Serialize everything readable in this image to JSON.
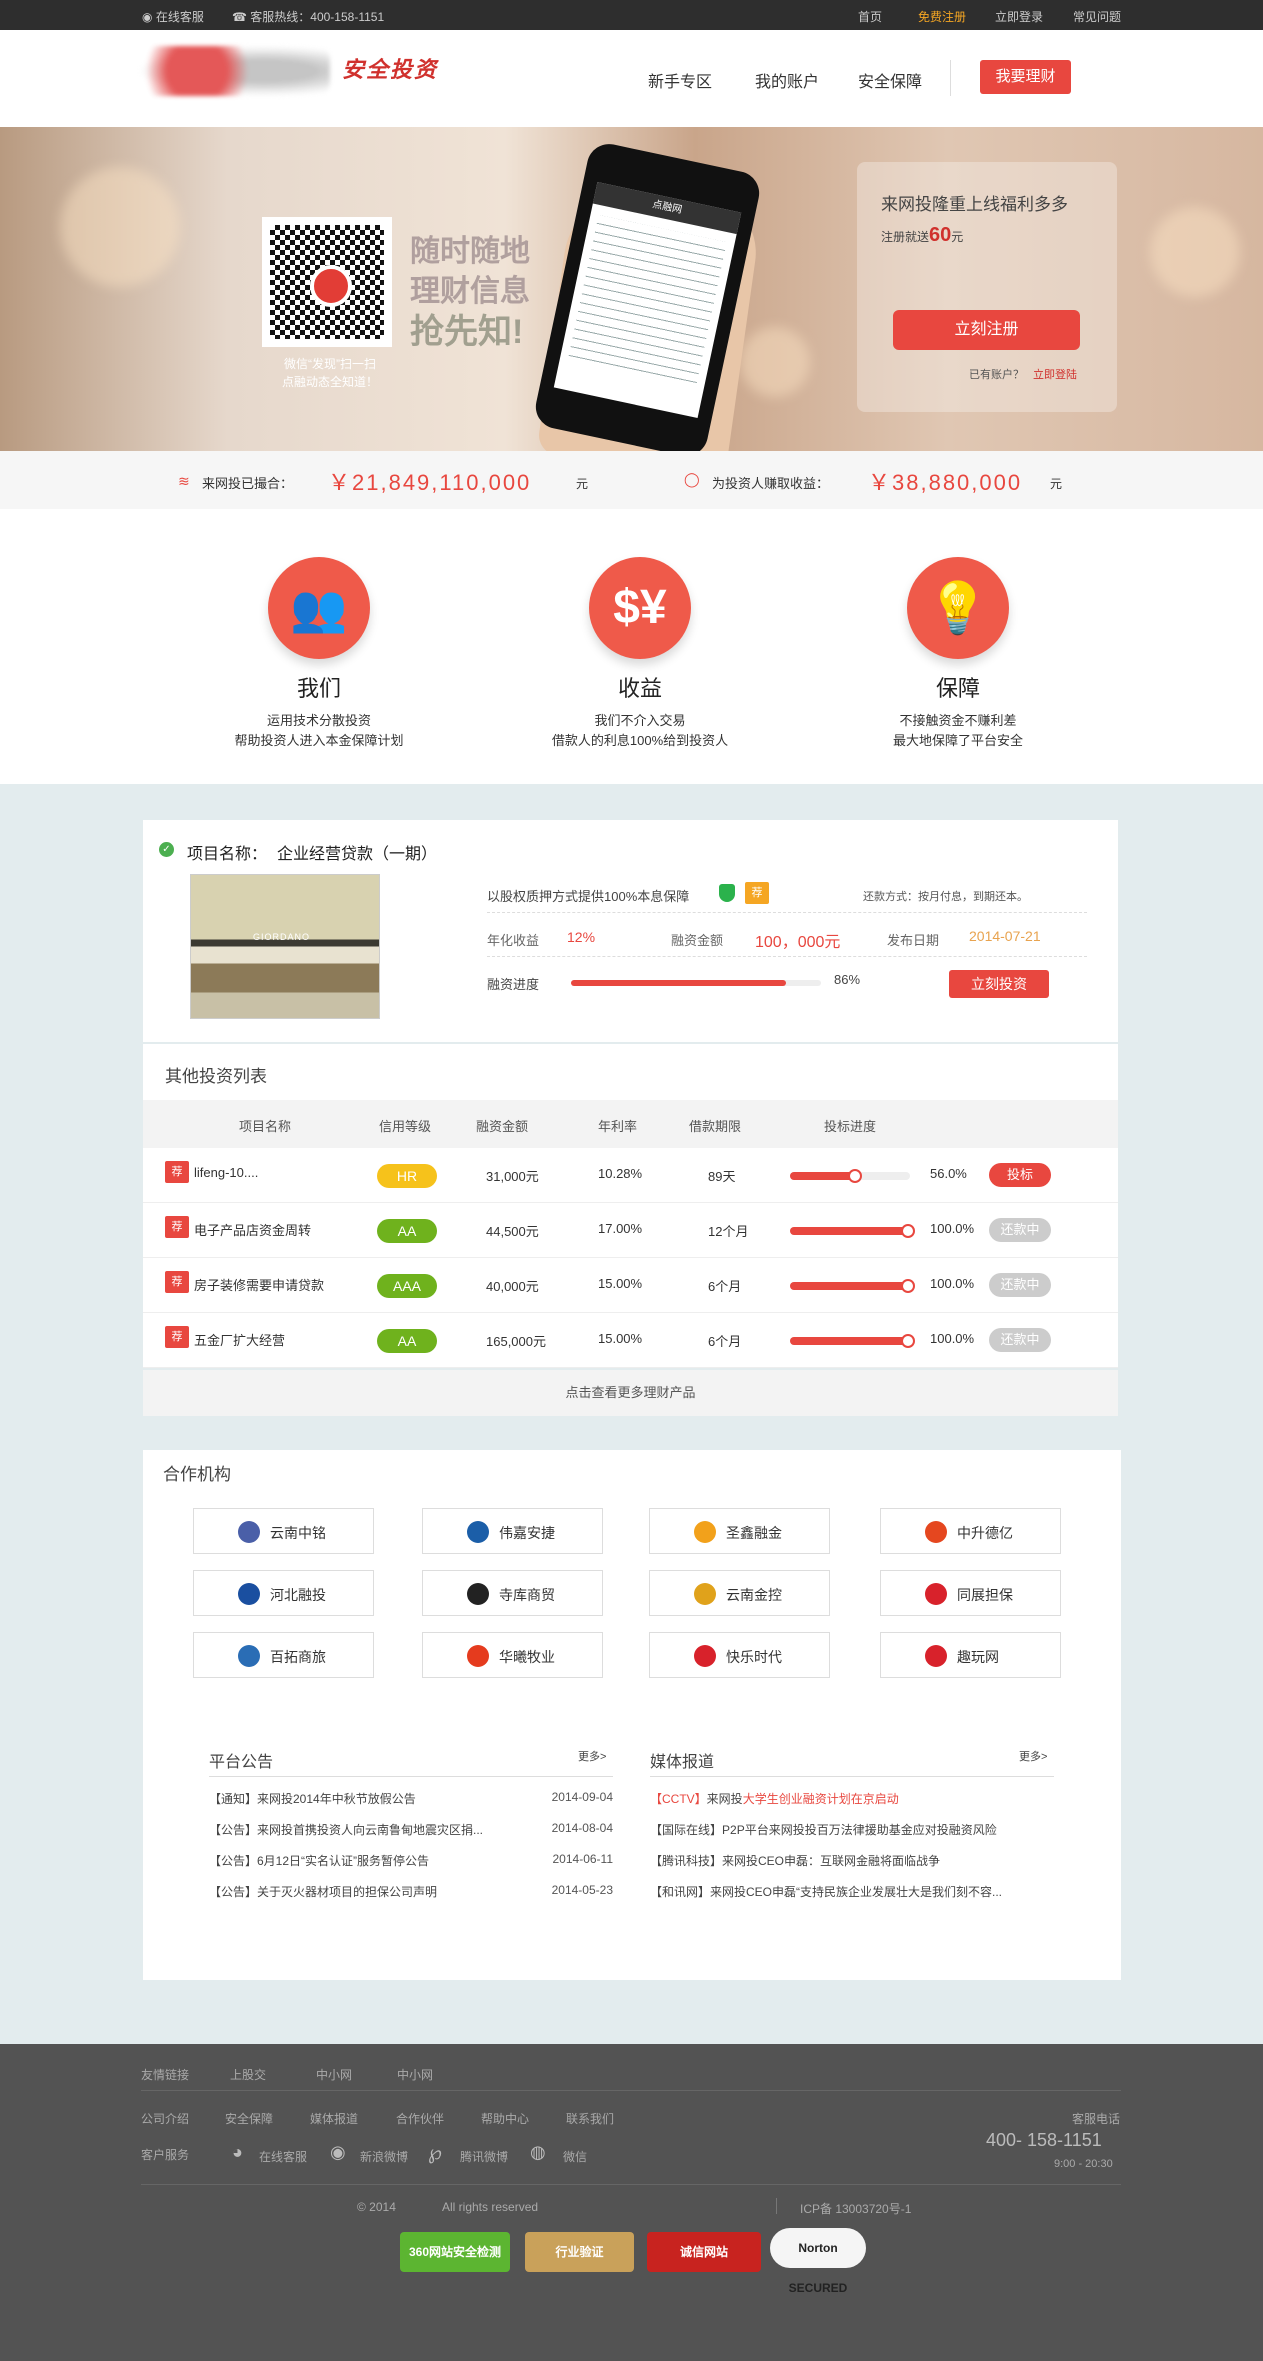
{
  "topbar": {
    "online_service": "在线客服",
    "hotline": "客服热线：400-158-1151",
    "links": [
      "首页",
      "免费注册",
      "立即登录",
      "常见问题"
    ]
  },
  "header": {
    "slogan": "安全投资",
    "nav": [
      "新手专区",
      "我的账户",
      "安全保障"
    ],
    "cta": "我要理财"
  },
  "banner": {
    "qr_caption_1": "微信“发现”扫一扫",
    "qr_caption_2": "点融动态全知道！",
    "slogan_line1": "随时随地",
    "slogan_line2": "理财信息",
    "slogan_line3": "抢先知!",
    "panel_title": "来网投隆重上线福利多多",
    "panel_reg_prefix": "注册就送",
    "panel_reg_amount": "60",
    "panel_reg_suffix": "元",
    "panel_button": "立刻注册",
    "panel_have_account": "已有账户？",
    "panel_login": "立即登陆",
    "phone_title": "点融网"
  },
  "stats": {
    "raised_label": "来网投已撮合：",
    "raised_value": "￥21,849,110,000",
    "raised_unit": "元",
    "earned_label": "为投资人赚取收益：",
    "earned_value": "￥38,880,000",
    "earned_unit": "元"
  },
  "features": [
    {
      "title": "我们",
      "line1": "运用技术分散投资",
      "line2": "帮助投资人进入本金保障计划",
      "icon": "people-icon"
    },
    {
      "title": "收益",
      "line1": "我们不介入交易",
      "line2": "借款人的利息100%给到投资人",
      "icon": "dollar-yen-icon"
    },
    {
      "title": "保障",
      "line1": "不接触资金不赚利差",
      "line2": "最大地保障了平台安全",
      "icon": "lightbulb-icon"
    }
  ],
  "project": {
    "name_label": "项目名称：",
    "name": "企业经营贷款（一期）",
    "guarantee": "以股权质押方式提供100%本息保障",
    "tag": "荐",
    "repay": "还款方式：按月付息，到期还本。",
    "rate_label": "年化收益",
    "rate": "12%",
    "amount_label": "融资金额",
    "amount": "100，000元",
    "date_label": "发布日期",
    "date": "2014-07-21",
    "progress_label": "融资进度",
    "progress_text": "86%",
    "progress": 0.86,
    "button": "立刻投资",
    "store_sign": "GIORDANO"
  },
  "list": {
    "title": "其他投资列表",
    "headers": [
      "项目名称",
      "信用等级",
      "融资金额",
      "年利率",
      "借款期限",
      "投标进度"
    ],
    "rows": [
      {
        "tag": "荐",
        "name": "lifeng-10....",
        "grade": "HR",
        "grade_color": "#f6c21b",
        "amount": "31,000元",
        "rate": "10.28%",
        "term": "89天",
        "progress": 0.56,
        "progress_text": "56.0%",
        "action": "投标",
        "action_active": true
      },
      {
        "tag": "荐",
        "name": "电子产品店资金周转",
        "grade": "AA",
        "grade_color": "#6fb21d",
        "amount": "44,500元",
        "rate": "17.00%",
        "term": "12个月",
        "progress": 1.0,
        "progress_text": "100.0%",
        "action": "还款中",
        "action_active": false
      },
      {
        "tag": "荐",
        "name": "房子装修需要申请贷款",
        "grade": "AAA",
        "grade_color": "#6fb21d",
        "amount": "40,000元",
        "rate": "15.00%",
        "term": "6个月",
        "progress": 1.0,
        "progress_text": "100.0%",
        "action": "还款中",
        "action_active": false
      },
      {
        "tag": "荐",
        "name": "五金厂扩大经营",
        "grade": "AA",
        "grade_color": "#6fb21d",
        "amount": "165,000元",
        "rate": "15.00%",
        "term": "6个月",
        "progress": 1.0,
        "progress_text": "100.0%",
        "action": "还款中",
        "action_active": false
      }
    ],
    "more": "点击查看更多理财产品"
  },
  "partners": {
    "title": "合作机构",
    "items": [
      {
        "name": "云南中铭",
        "color": "#4a5fa8"
      },
      {
        "name": "伟嘉安捷",
        "color": "#1b5ea8"
      },
      {
        "name": "圣鑫融金",
        "color": "#f2a11b"
      },
      {
        "name": "中升德亿",
        "color": "#e5471f"
      },
      {
        "name": "河北融投",
        "color": "#1a4fa0"
      },
      {
        "name": "寺库商贸",
        "color": "#222222"
      },
      {
        "name": "云南金控",
        "color": "#e0a21b"
      },
      {
        "name": "同展担保",
        "color": "#d8222b"
      },
      {
        "name": "百拓商旅",
        "color": "#2a6db5"
      },
      {
        "name": "华曦牧业",
        "color": "#e53b1e"
      },
      {
        "name": "快乐时代",
        "color": "#d8222b"
      },
      {
        "name": "趣玩网",
        "color": "#d8222b"
      }
    ]
  },
  "notices": {
    "title": "平台公告",
    "more": "更多>",
    "items": [
      {
        "text": "【通知】来网投2014年中秋节放假公告",
        "date": "2014-09-04"
      },
      {
        "text": "【公告】来网投首携投资人向云南鲁甸地震灾区捐...",
        "date": "2014-08-04"
      },
      {
        "text": "【公告】6月12日“实名认证”服务暂停公告",
        "date": "2014-06-11"
      },
      {
        "text": "【公告】关于灭火器材项目的担保公司声明",
        "date": "2014-05-23"
      }
    ]
  },
  "media": {
    "title": "媒体报道",
    "more": "更多>",
    "items": [
      {
        "source": "【CCTV】",
        "text": "来网投",
        "highlight": "大学生创业融资计划在京启动"
      },
      {
        "source": "【国际在线】",
        "text": "P2P平台来网投投百万法律援助基金应对投融资风险",
        "highlight": ""
      },
      {
        "source": "【腾讯科技】",
        "text": "来网投CEO申磊：互联网金融将面临战争",
        "highlight": ""
      },
      {
        "source": "【和讯网】",
        "text": "来网投CEO申磊“支持民族企业发展壮大是我们刻不容...",
        "highlight": ""
      }
    ]
  },
  "footer": {
    "friend_links_label": "友情链接",
    "friend_links": [
      "上股交",
      "中小网",
      "中小网"
    ],
    "company_links": [
      "公司介绍",
      "安全保障",
      "媒体报道",
      "合作伙伴",
      "帮助中心",
      "联系我们"
    ],
    "service_label": "客户服务",
    "services": [
      "在线客服",
      "新浪微博",
      "腾讯微博",
      "微信"
    ],
    "phone_label": "客服电话",
    "phone": "400- 158-1151",
    "hours": "9:00 - 20:30",
    "copyright_year": "© 2014",
    "copyright": "All rights reserved",
    "icp": "ICP备 13003720号-1",
    "badges": [
      {
        "label": "360网站安全检测",
        "color": "#5cb531"
      },
      {
        "label": "行业验证",
        "color": "#c9a15a"
      },
      {
        "label": "诚信网站",
        "color": "#c8231f"
      },
      {
        "label": "Norton SECURED",
        "color": "#f5f5f5"
      }
    ]
  }
}
